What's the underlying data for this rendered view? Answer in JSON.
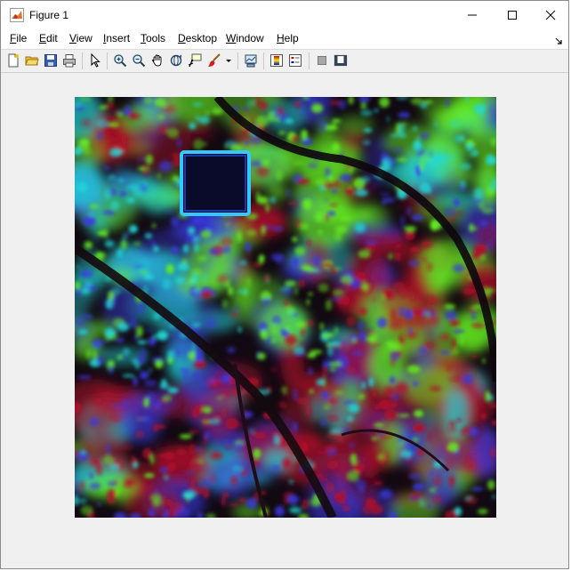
{
  "window": {
    "title": "Figure 1",
    "icon": "matlab-icon",
    "controls": [
      "minimize-icon",
      "maximize-icon",
      "close-icon"
    ]
  },
  "menubar": {
    "items": [
      {
        "label": "File",
        "accel": "F"
      },
      {
        "label": "Edit",
        "accel": "E"
      },
      {
        "label": "View",
        "accel": "V"
      },
      {
        "label": "Insert",
        "accel": "I"
      },
      {
        "label": "Tools",
        "accel": "T"
      },
      {
        "label": "Desktop",
        "accel": "D"
      },
      {
        "label": "Window",
        "accel": "W"
      },
      {
        "label": "Help",
        "accel": "H"
      }
    ],
    "dock_icon": "dock-arrow-icon"
  },
  "toolbar": {
    "buttons": [
      "new-figure-icon",
      "open-file-icon",
      "save-icon",
      "print-icon",
      "edit-plot-icon",
      "zoom-in-icon",
      "zoom-out-icon",
      "pan-icon",
      "rotate-3d-icon",
      "data-cursor-icon",
      "brush-icon",
      "brush-dropdown-icon",
      "link-plot-icon",
      "insert-colorbar-icon",
      "insert-legend-icon",
      "hide-plot-tools-icon",
      "show-plot-tools-icon"
    ]
  },
  "figure": {
    "content": "false-color-satellite-image",
    "colors": {
      "background": "#f0f0f0",
      "image_base": "#120a12",
      "red": "#b0102a",
      "green": "#66ee22",
      "cyan": "#22d8d8",
      "blue": "#3a3ae0",
      "dark_square": "#0a0a2a",
      "square_border": "#33c8ff"
    }
  }
}
